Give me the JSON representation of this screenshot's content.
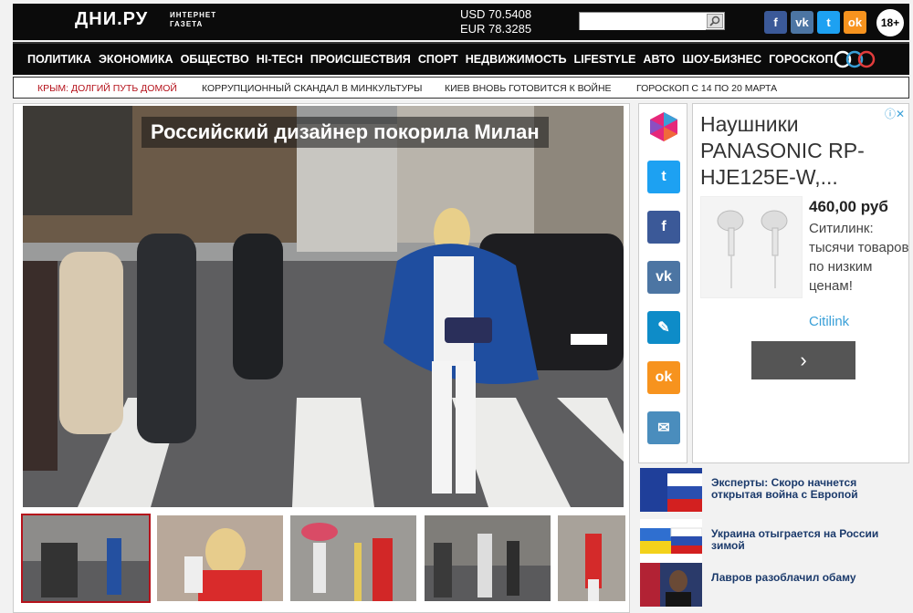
{
  "header": {
    "logo": "ДНИ.РУ",
    "logo_sub_1": "ИНТЕРНЕТ",
    "logo_sub_2": "ГАЗЕТА",
    "usd": "USD 70.5408",
    "eur": "EUR 78.3285",
    "search_placeholder": "",
    "age_rating": "18+",
    "social": [
      {
        "name": "facebook",
        "glyph": "f",
        "color": "#3b5998"
      },
      {
        "name": "vk",
        "glyph": "vk",
        "color": "#4c75a3"
      },
      {
        "name": "twitter",
        "glyph": "t",
        "color": "#1da1f2"
      },
      {
        "name": "odnoklassniki",
        "glyph": "ok",
        "color": "#f7931e"
      }
    ]
  },
  "nav": {
    "items": [
      "ПОЛИТИКА",
      "ЭКОНОМИКА",
      "ОБЩЕСТВО",
      "HI-TECH",
      "ПРОИСШЕСТВИЯ",
      "СПОРТ",
      "НЕДВИЖИМОСТЬ",
      "LIFESTYLE",
      "АВТО",
      "ШОУ-БИЗНЕС",
      "ГОРОСКОП"
    ]
  },
  "ticker": {
    "items": [
      {
        "label": "КРЫМ: ДОЛГИЙ ПУТЬ ДОМОЙ",
        "highlight": true
      },
      {
        "label": "КОРРУПЦИОННЫЙ СКАНДАЛ В МИНКУЛЬТУРЫ",
        "highlight": false
      },
      {
        "label": "КИЕВ ВНОВЬ ГОТОВИТСЯ К ВОЙНЕ",
        "highlight": false
      },
      {
        "label": "ГОРОСКОП С 14 ПО 20 МАРТА",
        "highlight": false
      }
    ]
  },
  "main": {
    "headline": "Российский дизайнер покорила Милан"
  },
  "share_icons": [
    {
      "name": "share-multi-icon",
      "glyph": "",
      "color": "#ffffff"
    },
    {
      "name": "twitter-share-icon",
      "glyph": "t",
      "color": "#1da1f2"
    },
    {
      "name": "facebook-share-icon",
      "glyph": "f",
      "color": "#3b5998"
    },
    {
      "name": "vk-share-icon",
      "glyph": "vk",
      "color": "#4c75a3"
    },
    {
      "name": "livejournal-share-icon",
      "glyph": "✎",
      "color": "#0e8cc8"
    },
    {
      "name": "odnoklassniki-share-icon",
      "glyph": "ok",
      "color": "#f7931e"
    },
    {
      "name": "email-share-icon",
      "glyph": "✉",
      "color": "#4a8dbd"
    }
  ],
  "ad": {
    "title": "Наушники PANASONIC RP-HJE125E-W,...",
    "price": "460,00 руб",
    "desc": "Ситилинк: тысячи товаров по низким ценам!",
    "link": "Citilink",
    "button": "›"
  },
  "news": [
    {
      "text": "Эксперты: Скоро начнется открытая война с Европой"
    },
    {
      "text": "Украина отыграется на России зимой"
    },
    {
      "text": "Лавров разоблачил обаму"
    }
  ]
}
